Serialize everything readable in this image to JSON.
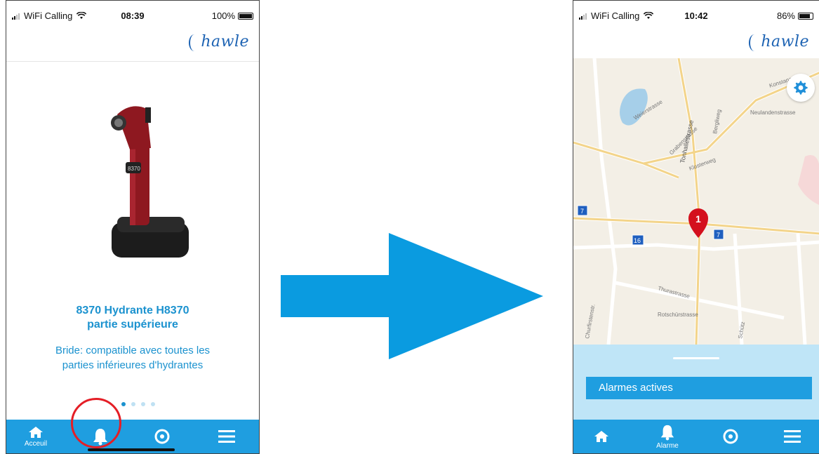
{
  "left_screen": {
    "status": {
      "carrier": "WiFi Calling",
      "time": "08:39",
      "battery": "100%",
      "battery_level": 1.0
    },
    "logo": "hawle",
    "product": {
      "title_line1": "8370 Hydrante H8370",
      "title_line2": "partie supérieure",
      "desc_line1": "Bride: compatible avec toutes les",
      "desc_line2": "parties inférieures d'hydrantes",
      "device_label": "8370"
    },
    "pager": {
      "count": 4,
      "active": 1
    },
    "tabs": [
      {
        "icon": "home-icon",
        "label": "Acceuil"
      },
      {
        "icon": "bell-icon",
        "label": ""
      },
      {
        "icon": "target-icon",
        "label": ""
      },
      {
        "icon": "menu-icon",
        "label": ""
      }
    ]
  },
  "right_screen": {
    "status": {
      "carrier": "WiFi Calling",
      "time": "10:42",
      "battery": "86%",
      "battery_level": 0.86
    },
    "logo": "hawle",
    "map": {
      "streets": [
        "Konstanzerstr.",
        "Neulandenstrasse",
        "Weierstrasse",
        "Grabenstrasse",
        "Tonhallestrasse",
        "Bergliweg",
        "Klosterweg",
        "Thurastrasse",
        "Rotschürstrasse",
        "Churfirstenstr.",
        "Schütz"
      ],
      "road_badges": [
        "7",
        "16",
        "7"
      ],
      "marker_number": "1"
    },
    "sheet": {
      "title": "Alarmes actives"
    },
    "tabs": [
      {
        "icon": "home-icon",
        "label": ""
      },
      {
        "icon": "bell-icon",
        "label": "Alarme"
      },
      {
        "icon": "target-icon",
        "label": ""
      },
      {
        "icon": "menu-icon",
        "label": ""
      }
    ]
  },
  "colors": {
    "accent": "#1f9ee0",
    "text_blue": "#1b92cf",
    "highlight_red": "#e41e26",
    "marker_red": "#d4101d",
    "arrow": "#0a9be0"
  }
}
